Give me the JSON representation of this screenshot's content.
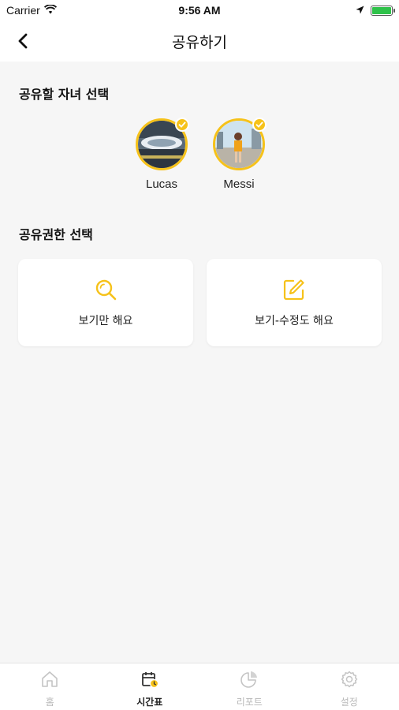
{
  "status_bar": {
    "carrier": "Carrier",
    "time": "9:56 AM"
  },
  "header": {
    "title": "공유하기",
    "back_icon": "chevron-left-icon"
  },
  "children_section": {
    "title": "공유할 자녀 선택",
    "children": [
      {
        "name": "Lucas",
        "selected": true
      },
      {
        "name": "Messi",
        "selected": true
      }
    ]
  },
  "permission_section": {
    "title": "공유권한 선택",
    "options": [
      {
        "label": "보기만 해요",
        "icon": "search-icon"
      },
      {
        "label": "보기-수정도 해요",
        "icon": "edit-icon"
      }
    ]
  },
  "tab_bar": {
    "tabs": [
      {
        "label": "홈",
        "icon": "home-icon",
        "active": false
      },
      {
        "label": "시간표",
        "icon": "calendar-clock-icon",
        "active": true
      },
      {
        "label": "리포트",
        "icon": "pie-chart-icon",
        "active": false
      },
      {
        "label": "설정",
        "icon": "gear-icon",
        "active": false
      }
    ]
  },
  "colors": {
    "accent": "#f6c21a",
    "background": "#f6f6f6",
    "card": "#ffffff",
    "inactive_tab": "#b9b9b9"
  }
}
